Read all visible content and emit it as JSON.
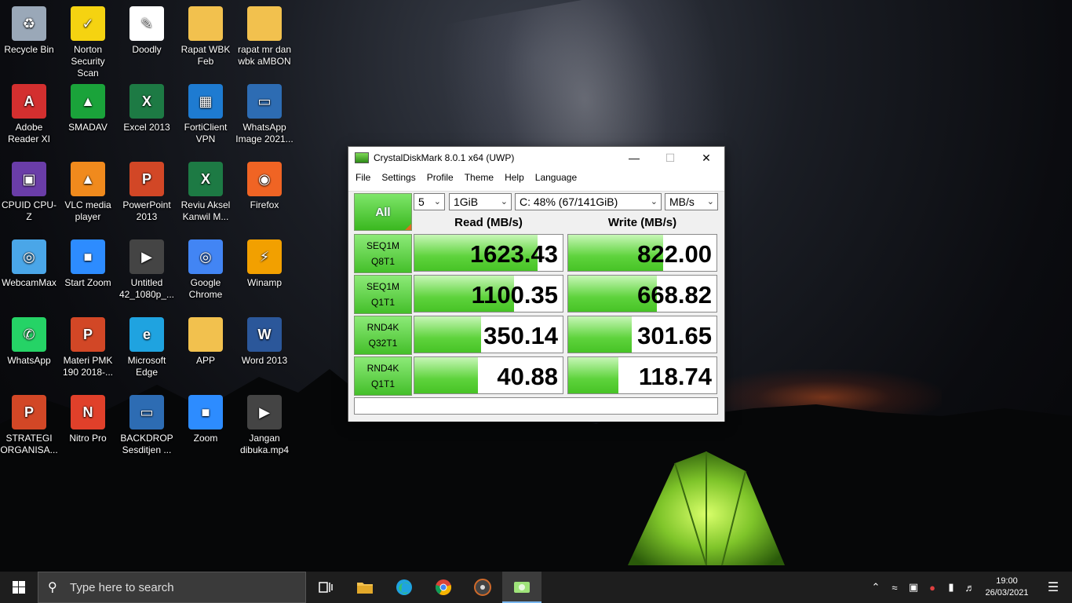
{
  "desktop": {
    "icons": [
      {
        "label": "Recycle Bin",
        "icon": "recycle-bin-icon"
      },
      {
        "label": "Norton Security Scan",
        "icon": "norton-icon"
      },
      {
        "label": "Doodly",
        "icon": "doodly-icon"
      },
      {
        "label": "Rapat WBK Feb",
        "icon": "folder-icon"
      },
      {
        "label": "rapat mr dan wbk aMBON",
        "icon": "folder-icon"
      },
      {
        "label": "Adobe Reader XI",
        "icon": "adobe-reader-icon"
      },
      {
        "label": "SMADAV",
        "icon": "smadav-icon"
      },
      {
        "label": "Excel 2013",
        "icon": "excel-icon"
      },
      {
        "label": "FortiClient VPN",
        "icon": "forticlient-icon"
      },
      {
        "label": "WhatsApp Image 2021...",
        "icon": "image-file-icon"
      },
      {
        "label": "CPUID CPU-Z",
        "icon": "cpuz-icon"
      },
      {
        "label": "VLC media player",
        "icon": "vlc-icon"
      },
      {
        "label": "PowerPoint 2013",
        "icon": "powerpoint-icon"
      },
      {
        "label": "Reviu Aksel Kanwil M...",
        "icon": "excel-file-icon"
      },
      {
        "label": "Firefox",
        "icon": "firefox-icon"
      },
      {
        "label": "WebcamMax",
        "icon": "webcammax-icon"
      },
      {
        "label": "Start Zoom",
        "icon": "zoom-icon"
      },
      {
        "label": "Untitled 42_1080p_...",
        "icon": "video-file-icon"
      },
      {
        "label": "Google Chrome",
        "icon": "chrome-icon"
      },
      {
        "label": "Winamp",
        "icon": "winamp-icon"
      },
      {
        "label": "WhatsApp",
        "icon": "whatsapp-icon"
      },
      {
        "label": "Materi PMK 190 2018-...",
        "icon": "powerpoint-file-icon"
      },
      {
        "label": "Microsoft Edge",
        "icon": "edge-icon"
      },
      {
        "label": "APP",
        "icon": "folder-icon"
      },
      {
        "label": "Word 2013",
        "icon": "word-icon"
      },
      {
        "label": "STRATEGI ORGANISA...",
        "icon": "powerpoint-file-icon"
      },
      {
        "label": "Nitro Pro",
        "icon": "nitro-icon"
      },
      {
        "label": "BACKDROP Sesditjen ...",
        "icon": "image-file-icon"
      },
      {
        "label": "Zoom",
        "icon": "zoom-icon"
      },
      {
        "label": "Jangan dibuka.mp4",
        "icon": "video-file-icon"
      }
    ]
  },
  "window": {
    "title": "CrystalDiskMark 8.0.1 x64 (UWP)",
    "minimize": "—",
    "maximize": "☐",
    "close": "✕",
    "menu": [
      "File",
      "Settings",
      "Profile",
      "Theme",
      "Help",
      "Language"
    ],
    "all_button": "All",
    "count": "5",
    "size": "1GiB",
    "drive": "C: 48% (67/141GiB)",
    "unit": "MB/s",
    "read_header": "Read (MB/s)",
    "write_header": "Write (MB/s)",
    "rows": [
      {
        "line1": "SEQ1M",
        "line2": "Q8T1",
        "read": "1623.43",
        "write": "822.00",
        "read_fill": 0.83,
        "write_fill": 0.64
      },
      {
        "line1": "SEQ1M",
        "line2": "Q1T1",
        "read": "1100.35",
        "write": "668.82",
        "read_fill": 0.67,
        "write_fill": 0.6
      },
      {
        "line1": "RND4K",
        "line2": "Q32T1",
        "read": "350.14",
        "write": "301.65",
        "read_fill": 0.45,
        "write_fill": 0.43
      },
      {
        "line1": "RND4K",
        "line2": "Q1T1",
        "read": "40.88",
        "write": "118.74",
        "read_fill": 0.43,
        "write_fill": 0.34
      }
    ],
    "status": ""
  },
  "taskbar": {
    "search_placeholder": "Type here to search",
    "time": "19:00",
    "date": "26/03/2021",
    "colors": {
      "accent": "#7ab7f0",
      "bar_fill": "#47c326"
    }
  }
}
